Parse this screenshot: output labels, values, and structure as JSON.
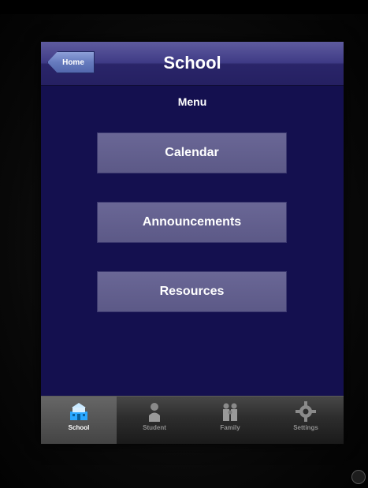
{
  "navbar": {
    "back_label": "Home",
    "title": "School"
  },
  "menu": {
    "title": "Menu",
    "items": [
      {
        "label": "Calendar"
      },
      {
        "label": "Announcements"
      },
      {
        "label": "Resources"
      }
    ]
  },
  "tabbar": {
    "tabs": [
      {
        "label": "School",
        "icon": "school-icon",
        "active": true
      },
      {
        "label": "Student",
        "icon": "student-icon"
      },
      {
        "label": "Family",
        "icon": "family-icon"
      },
      {
        "label": "Settings",
        "icon": "gear-icon"
      }
    ]
  },
  "colors": {
    "screen_background": "#14104f",
    "navbar": "#2a2569",
    "menu_button": "#5c5987",
    "tabbar": "#2d2d2d"
  }
}
